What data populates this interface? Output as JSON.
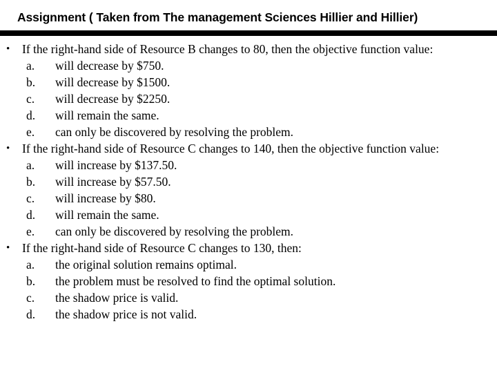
{
  "title": "Assignment ( Taken from The management Sciences Hillier and Hillier)",
  "bullet_glyph": "•",
  "questions": [
    {
      "stem": "If the right-hand side of Resource B changes to 80, then the objective function value:",
      "options": [
        {
          "letter": "a.",
          "text": "will decrease by $750."
        },
        {
          "letter": "b.",
          "text": "will decrease by $1500."
        },
        {
          "letter": "c.",
          "text": "will decrease by $2250."
        },
        {
          "letter": "d.",
          "text": "will remain the same."
        },
        {
          "letter": "e.",
          "text": "can only be discovered by resolving the problem."
        }
      ]
    },
    {
      "stem": "If the right-hand side of Resource C changes to 140, then the objective function value:",
      "options": [
        {
          "letter": "a.",
          "text": "will increase by $137.50."
        },
        {
          "letter": "b.",
          "text": "will increase by $57.50."
        },
        {
          "letter": "c.",
          "text": "will increase by $80."
        },
        {
          "letter": "d.",
          "text": "will remain the same."
        },
        {
          "letter": "e.",
          "text": "can only be discovered by resolving the problem."
        }
      ]
    },
    {
      "stem": "If the right-hand side of Resource C changes to 130, then:",
      "options": [
        {
          "letter": "a.",
          "text": "the original solution remains optimal."
        },
        {
          "letter": "b.",
          "text": "the problem must be resolved to find the optimal solution."
        },
        {
          "letter": "c.",
          "text": "the shadow price is valid."
        },
        {
          "letter": "d.",
          "text": "the shadow price is not valid."
        }
      ]
    }
  ]
}
